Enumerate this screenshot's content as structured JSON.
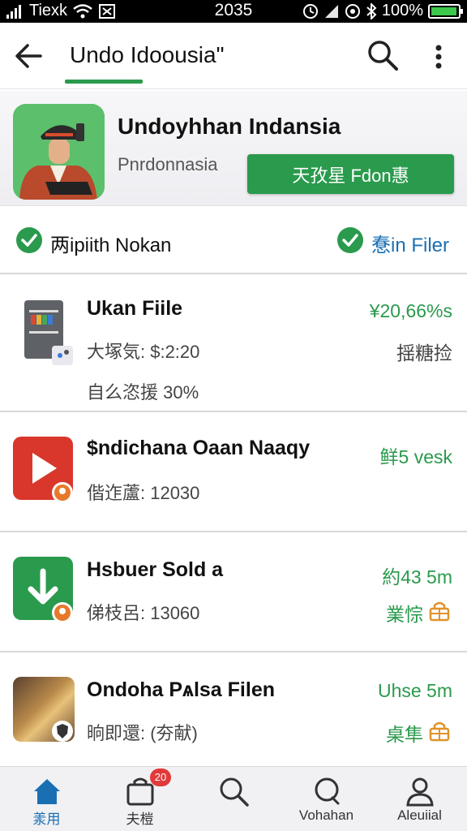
{
  "status_bar": {
    "carrier": "Tiexk",
    "time": "2035",
    "battery": "100%",
    "battery_level": 0.9
  },
  "app_bar": {
    "title": "Undo Idoousia\""
  },
  "app_header": {
    "name": "Undoyhhan Indansia",
    "developer": "Pnrdonnasia",
    "install_label": "天孜星 Fdon惠"
  },
  "badges": {
    "left": "两ipiith Nokan",
    "right": "惷in Filer"
  },
  "items": [
    {
      "title": "Ukan Fiile",
      "sub1": "大塚気: $:2:20",
      "sub2": "自么恣援 30%",
      "right1": "¥20,66%s",
      "right2": "揺糖捡"
    },
    {
      "title": "$ndichana Oaan Naaqy",
      "sub1": "偕迮蘆: 12030",
      "right1": "鲜5 vesk"
    },
    {
      "title": "Hsbuer Sold a",
      "sub1": "俤枝呂: 13060",
      "right1": "約43 5m",
      "right2": "業悰"
    },
    {
      "title": "Ondoha Pѧlsa Filen",
      "sub1": "晌即還: (夯献)",
      "right1": "Uhse 5m",
      "right2": "桌隼"
    }
  ],
  "bottom_nav": [
    {
      "label": "羕用",
      "icon": "home-icon",
      "active": true
    },
    {
      "label": "夫榿",
      "icon": "bag-icon",
      "badge": "20"
    },
    {
      "label": "",
      "icon": "search-icon"
    },
    {
      "label": "Vohahan",
      "icon": "chat-icon"
    },
    {
      "label": "Aleuiial",
      "icon": "person-icon"
    }
  ],
  "colors": {
    "accent_green": "#2a9a4c",
    "link_blue": "#1a6fb3",
    "badge_red": "#e23a3a"
  }
}
